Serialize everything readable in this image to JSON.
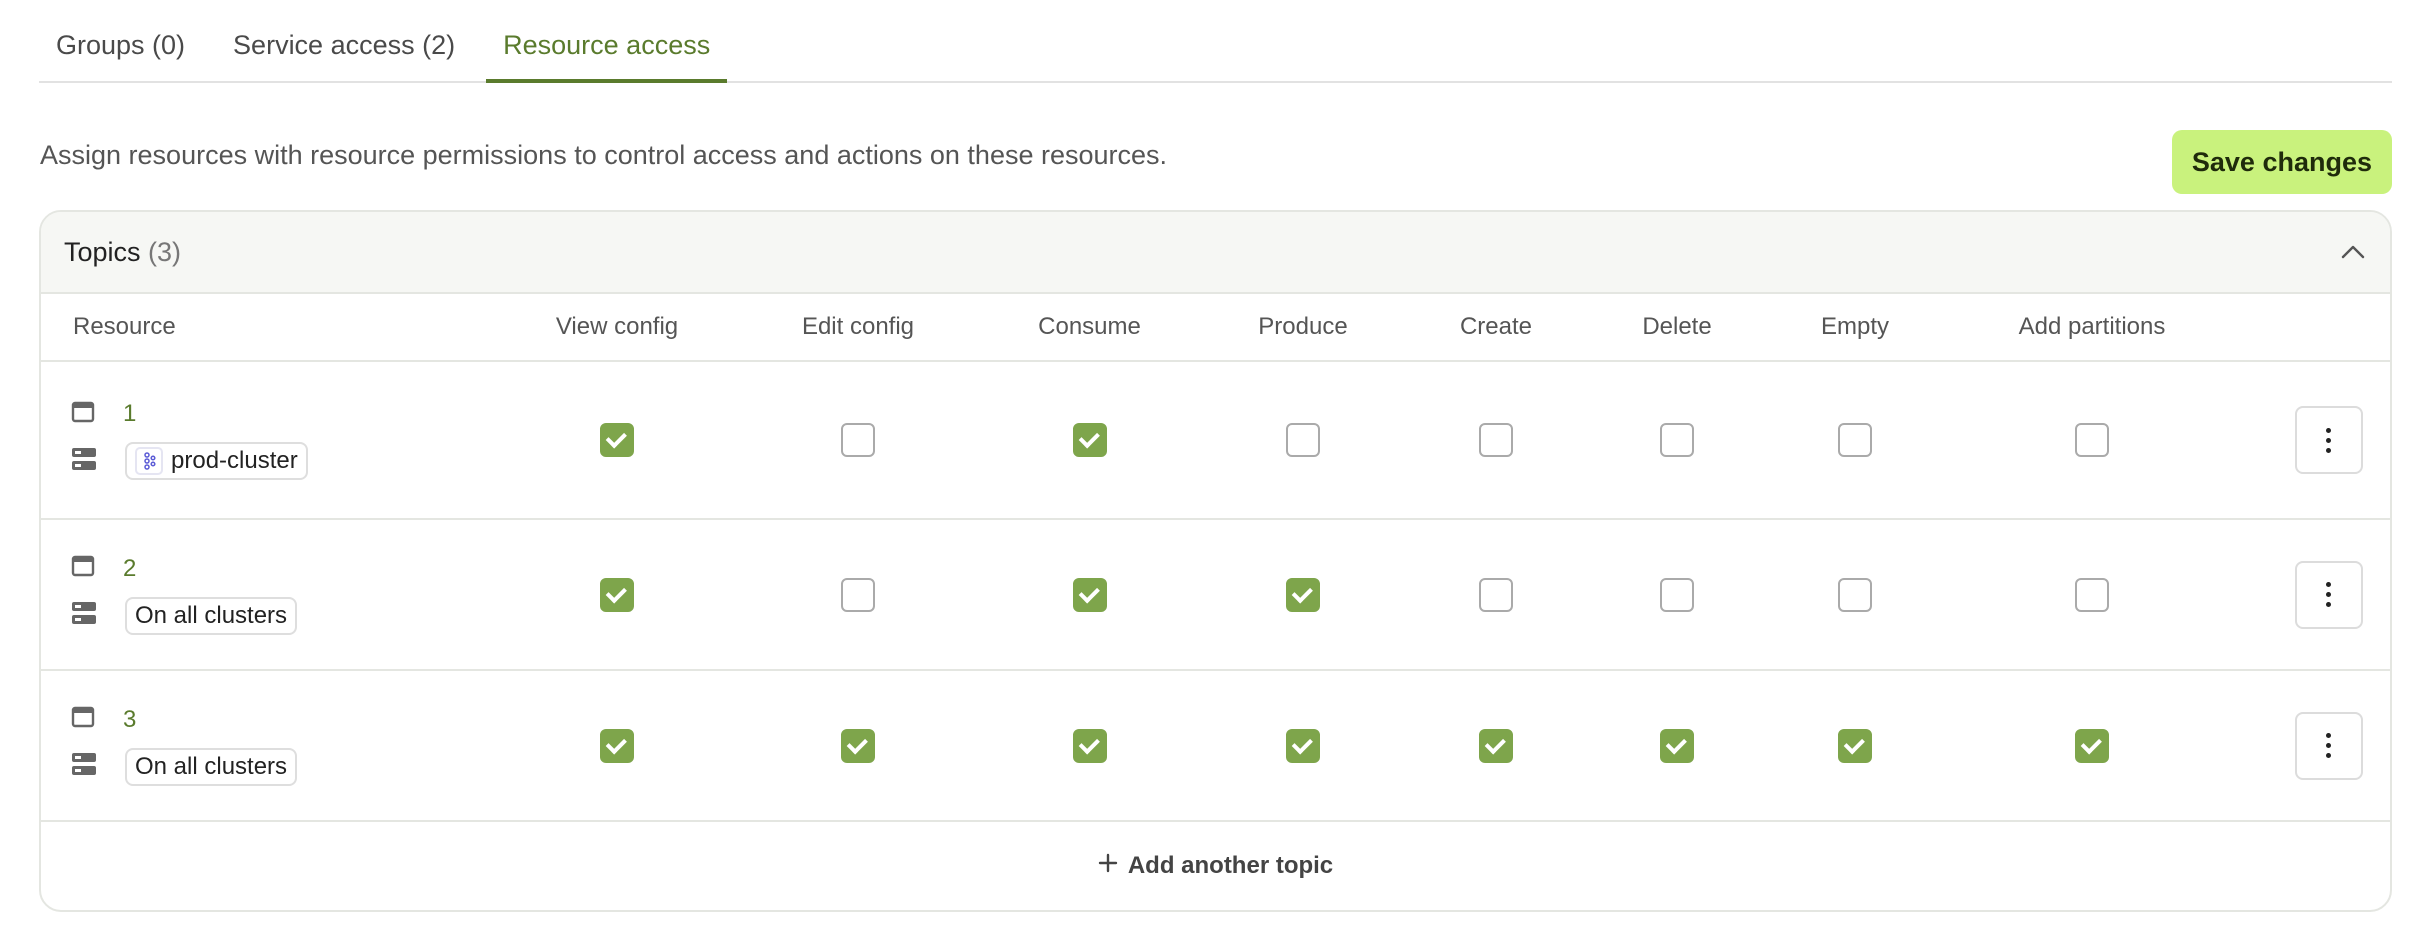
{
  "tabs": [
    {
      "label": "Groups (0)"
    },
    {
      "label": "Service access (2)"
    },
    {
      "label": "Resource access"
    }
  ],
  "description": "Assign resources with resource permissions to control access and actions on these resources.",
  "save_label": "Save changes",
  "card": {
    "title": "Topics",
    "count": "(3)"
  },
  "columns": [
    "Resource",
    "View config",
    "Edit config",
    "Consume",
    "Produce",
    "Create",
    "Delete",
    "Empty",
    "Add partitions"
  ],
  "rows": [
    {
      "name": "1",
      "cluster": "prod-cluster",
      "cluster_has_icon": true,
      "perms": [
        true,
        false,
        true,
        false,
        false,
        false,
        false,
        false
      ]
    },
    {
      "name": "2",
      "cluster": "On all clusters",
      "cluster_has_icon": false,
      "perms": [
        true,
        false,
        true,
        true,
        false,
        false,
        false,
        false
      ]
    },
    {
      "name": "3",
      "cluster": "On all clusters",
      "cluster_has_icon": false,
      "perms": [
        true,
        true,
        true,
        true,
        true,
        true,
        true,
        true
      ]
    }
  ],
  "add_label": "Add another topic",
  "colors": {
    "accent": "#5a7b2d",
    "save_bg": "#c9f27d",
    "checked": "#7ea54b"
  },
  "icons": [
    "topic-icon",
    "cluster-icon",
    "kafka-icon",
    "chevron-up-icon",
    "kebab-menu-icon",
    "plus-icon"
  ]
}
